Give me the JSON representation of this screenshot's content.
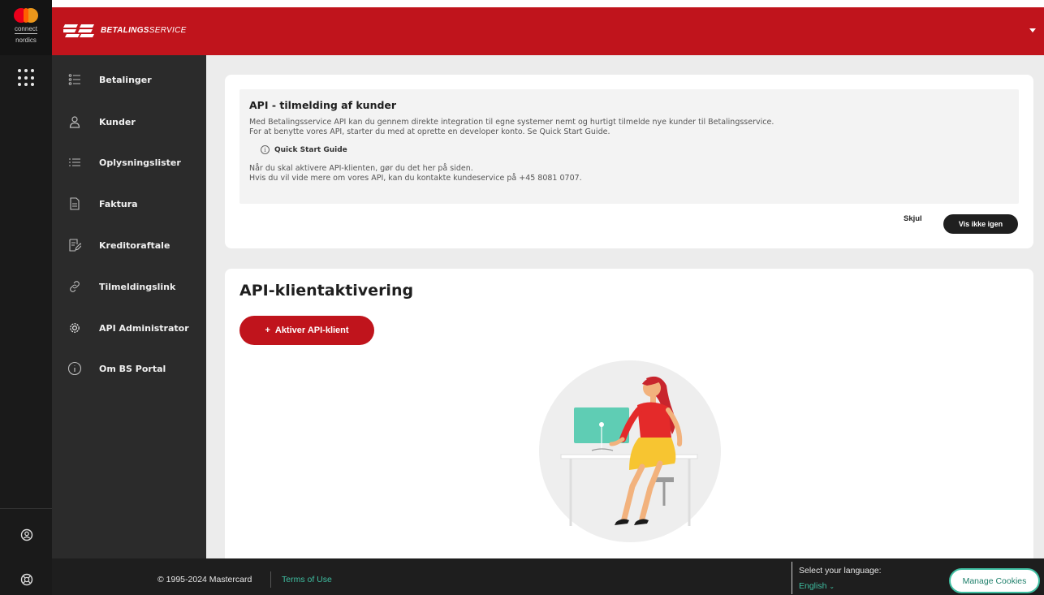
{
  "brand": {
    "rail_logo_line1": "connect",
    "rail_logo_line2": "nordics",
    "product_bold": "BETALINGS",
    "product_light": "SERVICE"
  },
  "sidebar": {
    "items": [
      {
        "label": "Betalinger",
        "icon": "payments-list-icon"
      },
      {
        "label": "Kunder",
        "icon": "user-icon"
      },
      {
        "label": "Oplysningslister",
        "icon": "list-icon"
      },
      {
        "label": "Faktura",
        "icon": "invoice-icon"
      },
      {
        "label": "Kreditoraftale",
        "icon": "contract-edit-icon"
      },
      {
        "label": "Tilmeldingslink",
        "icon": "link-icon"
      },
      {
        "label": "API Administrator",
        "icon": "gear-icon"
      },
      {
        "label": "Om BS Portal",
        "icon": "info-icon"
      }
    ]
  },
  "info_card": {
    "title": "API - tilmelding af kunder",
    "line1": "Med Betalingsservice API kan du gennem direkte integration til egne systemer nemt og hurtigt tilmelde nye kunder til Betalingsservice.",
    "line2": "For at benytte vores API, starter du med at oprette en developer konto. Se Quick Start Guide.",
    "quick_start": "Quick Start Guide",
    "line3": "Når du skal aktivere API-klienten, gør du det her på siden.",
    "line4": "Hvis du vil vide mere om vores API, kan du kontakte kundeservice på +45 8081 0707.",
    "hide_label": "Skjul",
    "dont_show_label": "Vis ikke igen"
  },
  "activation": {
    "title": "API-klientaktivering",
    "button_label": "Aktiver API-klient",
    "button_icon": "+"
  },
  "footer": {
    "copyright": "© 1995-2024 Mastercard",
    "terms": "Terms of Use",
    "language_label": "Select your language:",
    "language_value": "English",
    "cookies": "Manage Cookies"
  },
  "colors": {
    "brand_red": "#c0141c",
    "sidebar_bg": "#2b2b2b",
    "accent_teal": "#3fbfa2"
  }
}
